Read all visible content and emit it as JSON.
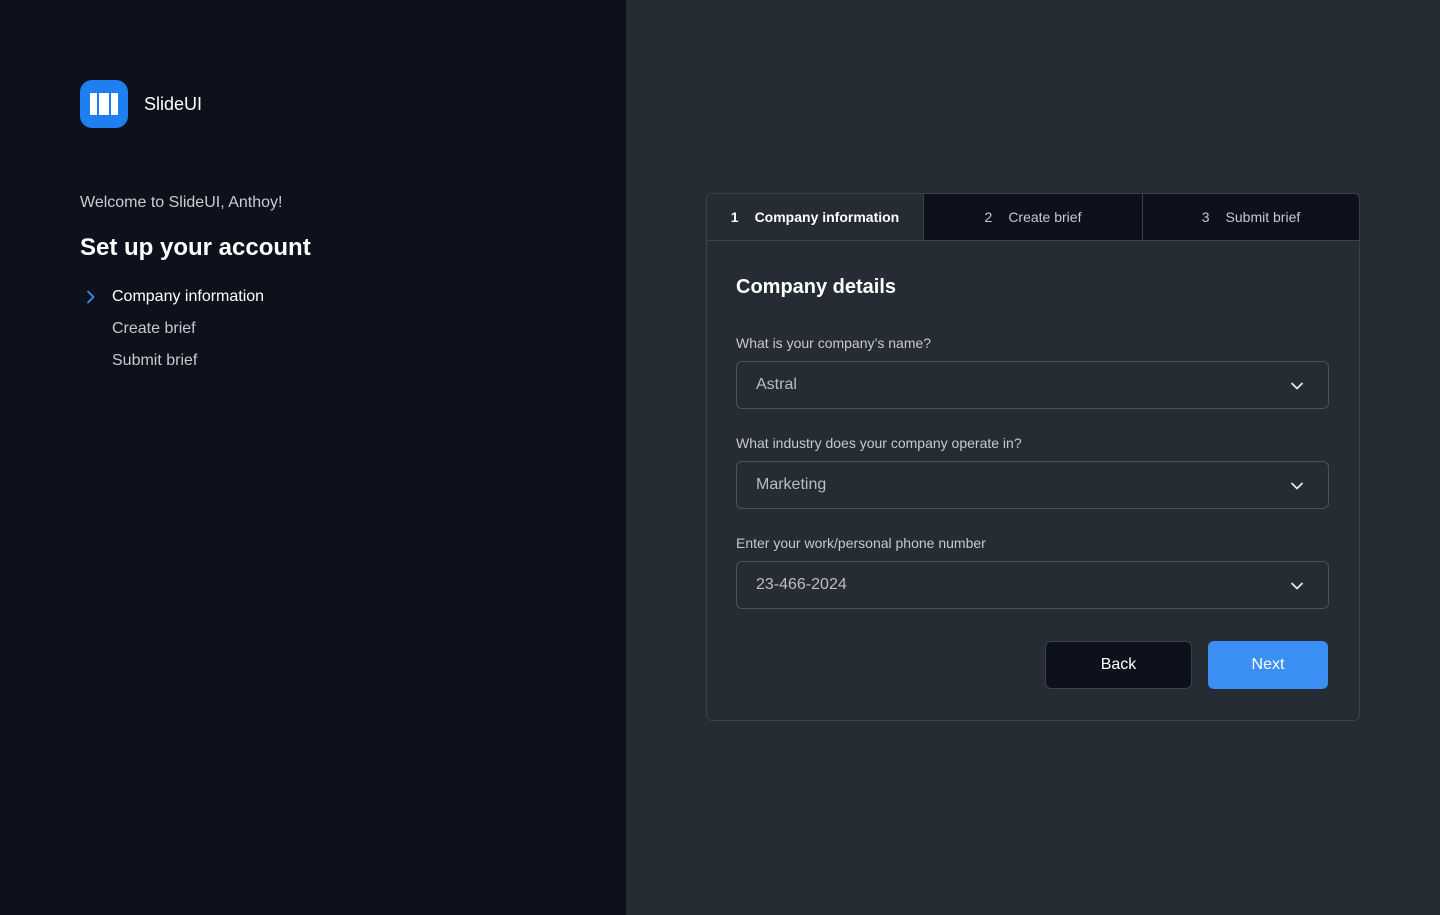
{
  "brand": {
    "name": "SlideUI",
    "logo_icon": "columns-logo-icon",
    "accent": "#1d7ff0"
  },
  "sidebar": {
    "welcome": "Welcome to SlideUI, Anthoy!",
    "title": "Set up your account",
    "steps": [
      {
        "label": "Company information",
        "active": true,
        "icon": "chevron-right-icon"
      },
      {
        "label": "Create brief",
        "active": false
      },
      {
        "label": "Submit brief",
        "active": false
      }
    ]
  },
  "tabs": [
    {
      "number": "1",
      "label": "Company information",
      "active": true
    },
    {
      "number": "2",
      "label": "Create brief",
      "active": false
    },
    {
      "number": "3",
      "label": "Submit brief",
      "active": false
    }
  ],
  "form": {
    "title": "Company details",
    "fields": [
      {
        "label": "What is your company’s name?",
        "value": "Astral",
        "icon": "chevron-down-icon"
      },
      {
        "label": "What industry does your company operate in?",
        "value": "Marketing",
        "icon": "chevron-down-icon"
      },
      {
        "label": "Enter your work/personal phone number",
        "value": "23-466-2024",
        "icon": "chevron-down-icon"
      }
    ],
    "back_label": "Back",
    "next_label": "Next",
    "next_color": "#3b8ff2"
  }
}
